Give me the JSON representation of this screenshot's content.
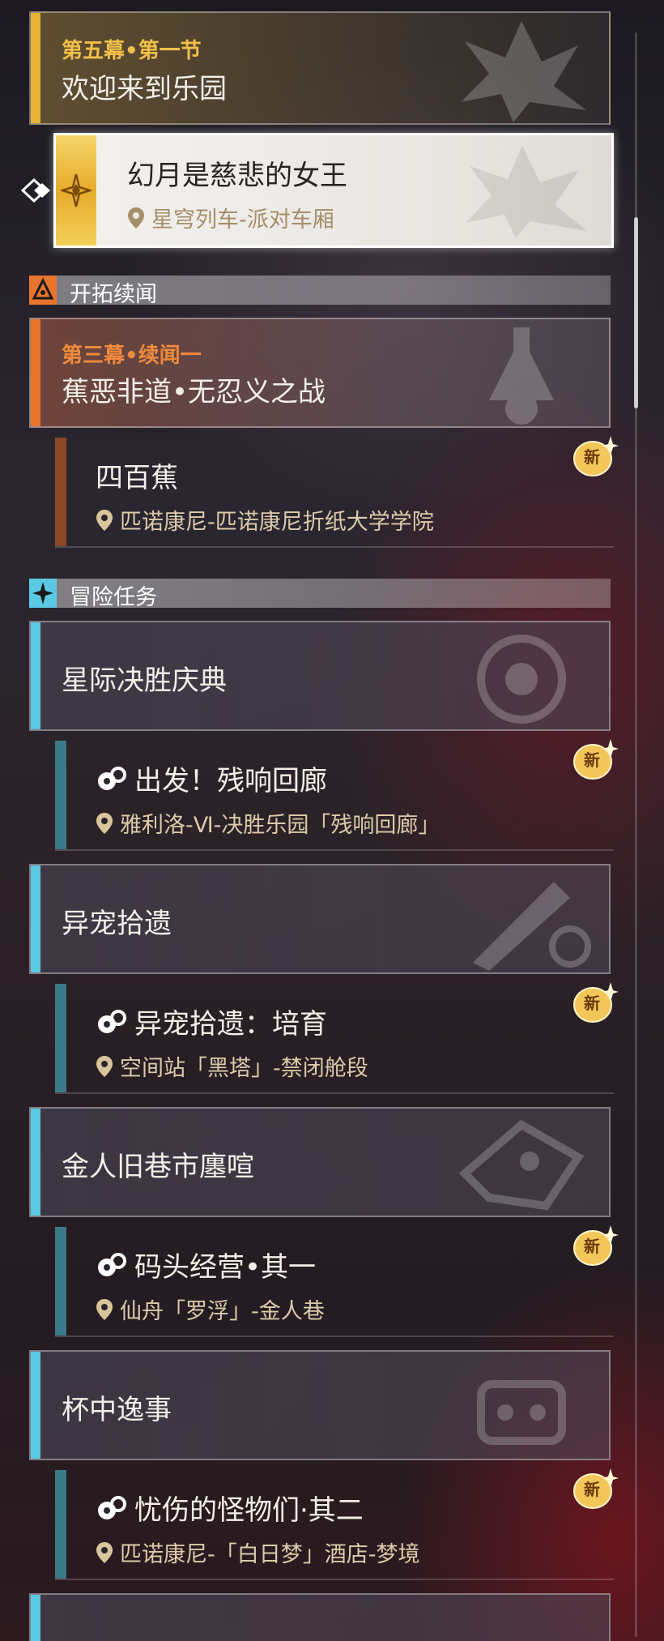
{
  "main_quest": {
    "chapter_label": "第五幕•第一节",
    "chapter_title": "欢迎来到乐园",
    "selected_quest": {
      "title": "幻月是慈悲的女王",
      "location": "星穹列车-派对车厢"
    }
  },
  "trailblaze_continuance": {
    "section_label": "开拓续闻",
    "chapter_label": "第三幕•续闻一",
    "chapter_title": "蕉恶非道•无忍义之战",
    "quest": {
      "title": "四百蕉",
      "location": "匹诺康尼-匹诺康尼折纸大学学院",
      "badge": "新"
    }
  },
  "adventure": {
    "section_label": "冒险任务",
    "groups": [
      {
        "title": "星际决胜庆典",
        "quest_title": "出发！残响回廊",
        "location": "雅利洛-Ⅵ-决胜乐园「残响回廊」",
        "badge": "新"
      },
      {
        "title": "异宠拾遗",
        "quest_title": "异宠拾遗：培育",
        "location": "空间站「黑塔」-禁闭舱段",
        "badge": "新"
      },
      {
        "title": "金人旧巷市廛喧",
        "quest_title": "码头经营•其一",
        "location": "仙舟「罗浮」-金人巷",
        "badge": "新"
      },
      {
        "title": "杯中逸事",
        "quest_title": "忧伤的怪物们·其二",
        "location": "匹诺康尼-「白日梦」酒店-梦境",
        "badge": "新"
      }
    ]
  },
  "colors": {
    "main_gold": "#e8b23a",
    "continuance_orange": "#e8742e",
    "adventure_cyan": "#5bc8e4",
    "quest_bar_brown": "#8a4a2a",
    "quest_bar_teal": "#3a7a88"
  }
}
